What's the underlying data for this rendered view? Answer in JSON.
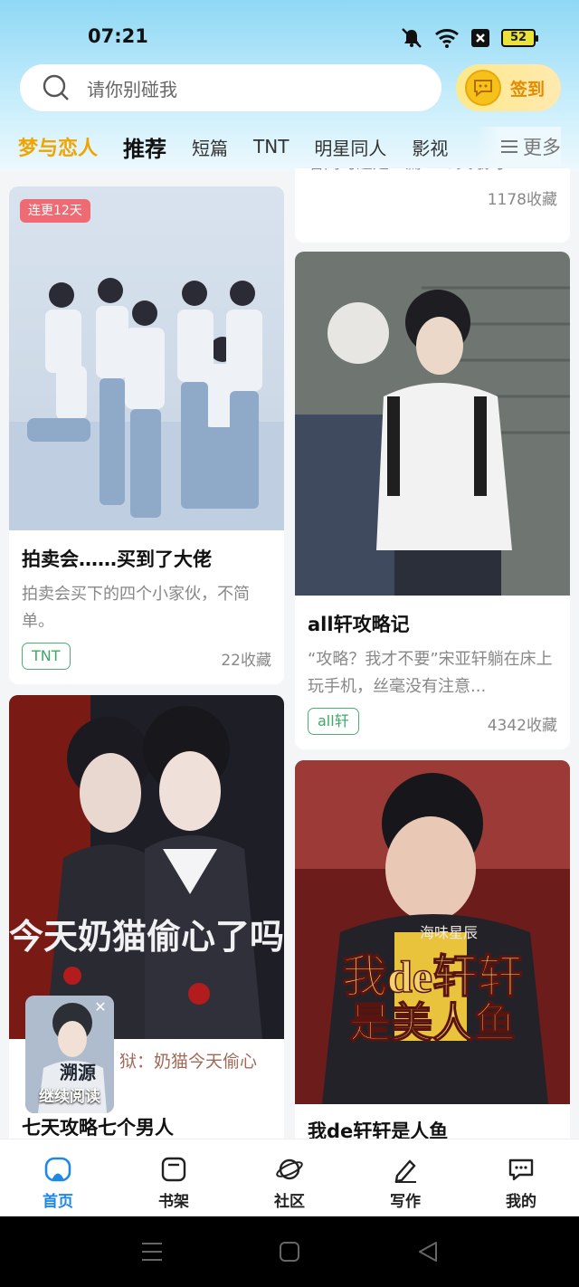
{
  "status_bar": {
    "time": "07:21",
    "battery": "52"
  },
  "search": {
    "placeholder": "请你别碰我"
  },
  "checkin": {
    "label": "签到"
  },
  "tabs": {
    "brand": "梦与恋人",
    "items": [
      "推荐",
      "短篇",
      "TNT",
      "明星同人",
      "影视"
    ],
    "more": "更多"
  },
  "feed": {
    "partial_card": {
      "desc": "看同时这是一篇ABO文哦可...",
      "collect": "1178收藏"
    },
    "card1": {
      "badge": "连更12天",
      "title": "拍卖会……买到了大佬",
      "desc": "拍卖会买下的四个小家伙，不简单。",
      "tag": "TNT",
      "collect": "22收藏"
    },
    "card2": {
      "title": "all轩攻略记",
      "desc": "“攻略？我才不要”宋亚轩躺在床上玩手机，丝毫没有注意...",
      "tag": "all轩",
      "collect": "4342收藏"
    },
    "card3": {
      "cover_text": "今天奶猫偷心了吗",
      "subtitle": "狱：奶猫今天偷心",
      "title": "七天攻略七个男人"
    },
    "card4": {
      "cover_text_1": "我de轩轩",
      "cover_text_2": "是美人鱼",
      "cover_author": "海味星辰",
      "title": "我de轩轩是人鱼"
    }
  },
  "float_continue": {
    "label": "继续阅读",
    "cover_text": "溯源"
  },
  "bottom_nav": [
    {
      "label": "首页",
      "icon": "home-icon"
    },
    {
      "label": "书架",
      "icon": "bookshelf-icon"
    },
    {
      "label": "社区",
      "icon": "planet-icon"
    },
    {
      "label": "写作",
      "icon": "pen-icon"
    },
    {
      "label": "我的",
      "icon": "chat-icon"
    }
  ],
  "colors": {
    "accent": "#1e88e5",
    "brand": "#f0a400",
    "tag": "#3ea866",
    "badge": "#ef6b74"
  }
}
